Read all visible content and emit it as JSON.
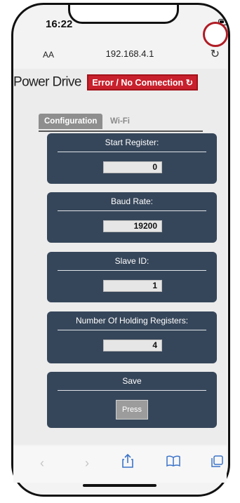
{
  "status_bar": {
    "time": "16:22"
  },
  "browser": {
    "text_size": "AA",
    "url": "192.168.4.1",
    "reload_icon": "reload-icon"
  },
  "header": {
    "title": "Power Drive",
    "status": "Error / No Connection ↻"
  },
  "tabs": [
    {
      "label": "Configuration",
      "active": true
    },
    {
      "label": "Wi-Fi",
      "active": false
    }
  ],
  "cards": [
    {
      "label": "Start Register:",
      "value": "0"
    },
    {
      "label": "Baud Rate:",
      "value": "19200"
    },
    {
      "label": "Slave ID:",
      "value": "1"
    },
    {
      "label": "Number Of Holding Registers:",
      "value": "4"
    }
  ],
  "save": {
    "label": "Save",
    "button": "Press"
  },
  "toolbar": {
    "back": "‹",
    "forward": "›",
    "share": "share-icon",
    "bookmarks": "bookmarks-icon",
    "tabs": "tabs-icon"
  },
  "colors": {
    "card": "#36465a",
    "badge": "#c8202c",
    "circle": "#b01c24"
  }
}
